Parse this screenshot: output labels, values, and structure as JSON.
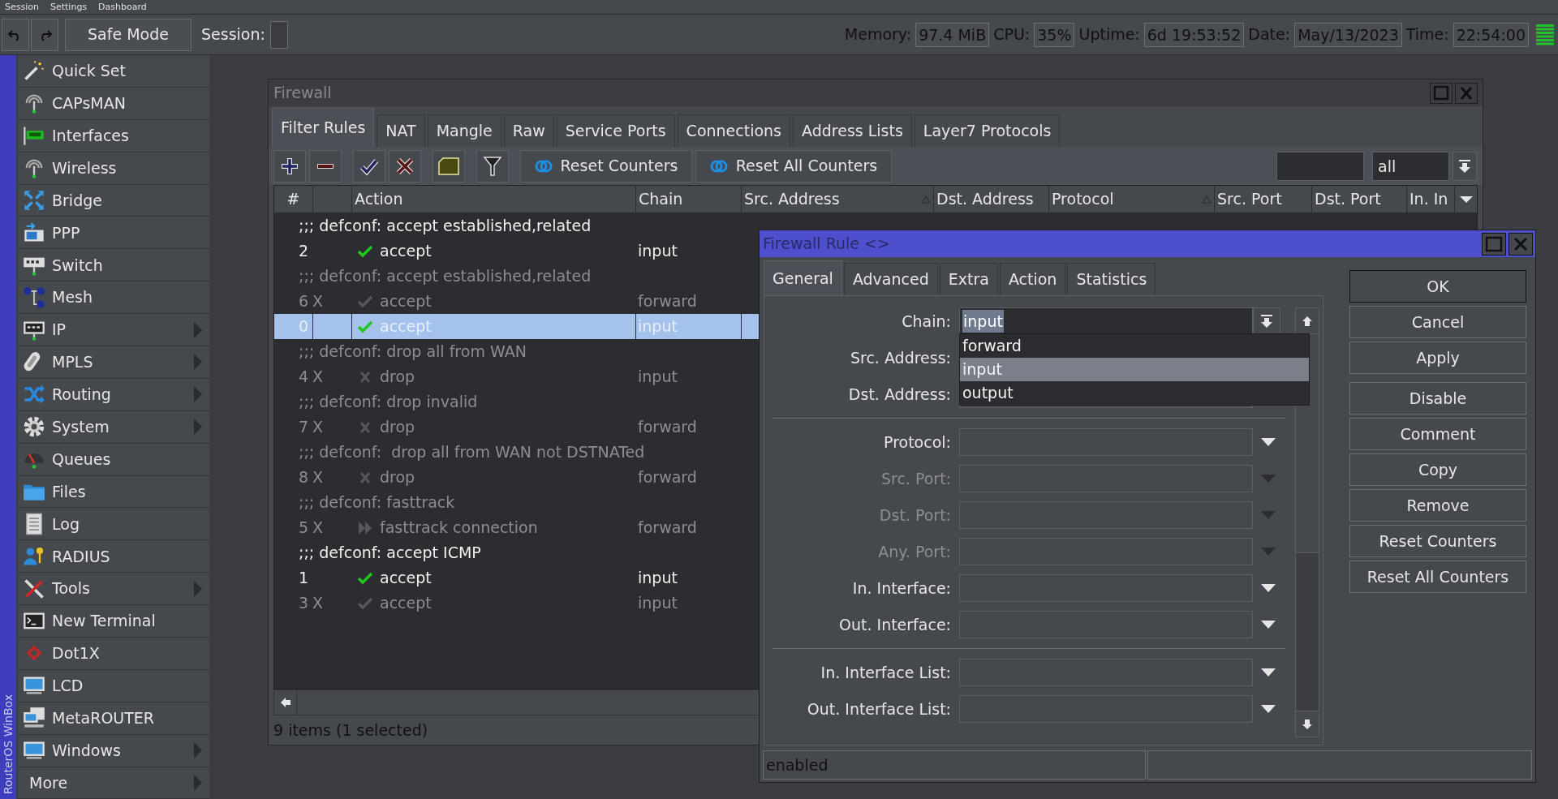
{
  "menu_bar": [
    {
      "label": "Session"
    },
    {
      "label": "Settings"
    },
    {
      "label": "Dashboard"
    }
  ],
  "toolbar": {
    "safe_mode": "Safe Mode",
    "session_label": "Session:",
    "stats": [
      {
        "label": "Memory:",
        "value": "97.4 MiB"
      },
      {
        "label": "CPU:",
        "value": "35%"
      },
      {
        "label": "Uptime:",
        "value": "6d 19:53:52"
      },
      {
        "label": "Date:",
        "value": "May/13/2023"
      },
      {
        "label": "Time:",
        "value": "22:54:00"
      }
    ]
  },
  "sidebar": {
    "brand": "RouterOS WinBox",
    "items": [
      {
        "label": "Quick Set",
        "submenu": false
      },
      {
        "label": "CAPsMAN",
        "submenu": false
      },
      {
        "label": "Interfaces",
        "submenu": false
      },
      {
        "label": "Wireless",
        "submenu": false
      },
      {
        "label": "Bridge",
        "submenu": false
      },
      {
        "label": "PPP",
        "submenu": false
      },
      {
        "label": "Switch",
        "submenu": false
      },
      {
        "label": "Mesh",
        "submenu": false
      },
      {
        "label": "IP",
        "submenu": true
      },
      {
        "label": "MPLS",
        "submenu": true
      },
      {
        "label": "Routing",
        "submenu": true
      },
      {
        "label": "System",
        "submenu": true
      },
      {
        "label": "Queues",
        "submenu": false
      },
      {
        "label": "Files",
        "submenu": false
      },
      {
        "label": "Log",
        "submenu": false
      },
      {
        "label": "RADIUS",
        "submenu": false
      },
      {
        "label": "Tools",
        "submenu": true
      },
      {
        "label": "New Terminal",
        "submenu": false
      },
      {
        "label": "Dot1X",
        "submenu": false
      },
      {
        "label": "LCD",
        "submenu": false
      },
      {
        "label": "MetaROUTER",
        "submenu": false
      },
      {
        "label": "Windows",
        "submenu": true
      },
      {
        "label": "More",
        "submenu": true
      }
    ]
  },
  "firewall": {
    "title": "Firewall",
    "tabs": [
      {
        "label": "Filter Rules",
        "selected": true
      },
      {
        "label": "NAT",
        "selected": false
      },
      {
        "label": "Mangle",
        "selected": false
      },
      {
        "label": "Raw",
        "selected": false
      },
      {
        "label": "Service Ports",
        "selected": false
      },
      {
        "label": "Connections",
        "selected": false
      },
      {
        "label": "Address Lists",
        "selected": false
      },
      {
        "label": "Layer7 Protocols",
        "selected": false
      }
    ],
    "actions": [
      {
        "label": "Reset Counters"
      },
      {
        "label": "Reset All Counters"
      }
    ],
    "filter": {
      "value": "all"
    },
    "columns": [
      {
        "label": "#",
        "sort_indicator": false
      },
      {
        "label": "Action",
        "sort_indicator": false
      },
      {
        "label": "Chain",
        "sort_indicator": false
      },
      {
        "label": "Src. Address",
        "sort_indicator": true
      },
      {
        "label": "Dst. Address",
        "sort_indicator": false
      },
      {
        "label": "Protocol",
        "sort_indicator": true
      },
      {
        "label": "Src. Port",
        "sort_indicator": false
      },
      {
        "label": "Dst. Port",
        "sort_indicator": false
      },
      {
        "label": "In. In",
        "sort_indicator": false
      }
    ],
    "rows": [
      {
        "kind": "comment",
        "text": ";;; defconf: accept established,related",
        "disabled": false
      },
      {
        "kind": "accept_rule",
        "number": "2",
        "action": "accept",
        "chain": "input",
        "disabled": false,
        "selected": false
      },
      {
        "kind": "comment",
        "text": ";;; defconf: accept established,related",
        "disabled": true
      },
      {
        "kind": "accept_rule",
        "number": "6",
        "flag": "X",
        "action": "accept",
        "chain": "forward",
        "disabled": true,
        "selected": false
      },
      {
        "kind": "accept_rule",
        "number": "0",
        "action": "accept",
        "chain": "input",
        "disabled": false,
        "selected": true
      },
      {
        "kind": "comment",
        "text": ";;; defconf: drop all from WAN",
        "disabled": true
      },
      {
        "kind": "drop_rule",
        "number": "4",
        "flag": "X",
        "action": "drop",
        "chain": "input",
        "disabled": true,
        "selected": false
      },
      {
        "kind": "comment",
        "text": ";;; defconf: drop invalid",
        "disabled": true
      },
      {
        "kind": "drop_rule",
        "number": "7",
        "flag": "X",
        "action": "drop",
        "chain": "forward",
        "disabled": true,
        "selected": false
      },
      {
        "kind": "comment",
        "text": ";;; defconf:  drop all from WAN not DSTNATed",
        "disabled": true
      },
      {
        "kind": "drop_rule",
        "number": "8",
        "flag": "X",
        "action": "drop",
        "chain": "forward",
        "disabled": true,
        "selected": false
      },
      {
        "kind": "comment",
        "text": ";;; defconf: fasttrack",
        "disabled": true
      },
      {
        "kind": "fasttrack_rule",
        "number": "5",
        "flag": "X",
        "action": "fasttrack connection",
        "chain": "forward",
        "disabled": true,
        "selected": false
      },
      {
        "kind": "comment",
        "text": ";;; defconf: accept ICMP",
        "disabled": false
      },
      {
        "kind": "accept_rule",
        "number": "1",
        "action": "accept",
        "chain": "input",
        "disabled": false,
        "selected": false
      },
      {
        "kind": "accept_rule",
        "number": "3",
        "flag": "X",
        "action": "accept",
        "chain": "input",
        "disabled": true,
        "selected": false
      }
    ],
    "status": "9 items (1 selected)"
  },
  "rule_dialog": {
    "title": "Firewall Rule <>",
    "tabs": [
      {
        "label": "General",
        "selected": true
      },
      {
        "label": "Advanced",
        "selected": false
      },
      {
        "label": "Extra",
        "selected": false
      },
      {
        "label": "Action",
        "selected": false
      },
      {
        "label": "Statistics",
        "selected": false
      }
    ],
    "field_groups": [
      [
        {
          "label": "Chain:",
          "kind": "combo",
          "value": "input",
          "disabled": false
        },
        {
          "label": "Src. Address:",
          "kind": "covered",
          "disabled": false
        },
        {
          "label": "Dst. Address:",
          "kind": "text",
          "disabled": false
        }
      ],
      [
        {
          "label": "Protocol:",
          "kind": "dropdown",
          "disabled": false
        },
        {
          "label": "Src. Port:",
          "kind": "dropdown",
          "disabled": true
        },
        {
          "label": "Dst. Port:",
          "kind": "dropdown",
          "disabled": true
        },
        {
          "label": "Any. Port:",
          "kind": "dropdown",
          "disabled": true
        },
        {
          "label": "In. Interface:",
          "kind": "dropdown",
          "disabled": false
        },
        {
          "label": "Out. Interface:",
          "kind": "dropdown",
          "disabled": false
        }
      ],
      [
        {
          "label": "In. Interface List:",
          "kind": "dropdown",
          "disabled": false
        },
        {
          "label": "Out. Interface List:",
          "kind": "dropdown",
          "disabled": false
        }
      ]
    ],
    "chain_options": [
      {
        "label": "forward",
        "selected": false
      },
      {
        "label": "input",
        "selected": true
      },
      {
        "label": "output",
        "selected": false
      }
    ],
    "button_groups": [
      [
        {
          "label": "OK",
          "default": true
        },
        {
          "label": "Cancel",
          "default": false
        },
        {
          "label": "Apply",
          "default": false
        }
      ],
      [
        {
          "label": "Disable",
          "default": false
        },
        {
          "label": "Comment",
          "default": false
        },
        {
          "label": "Copy",
          "default": false
        },
        {
          "label": "Remove",
          "default": false
        },
        {
          "label": "Reset Counters",
          "default": false
        },
        {
          "label": "Reset All Counters",
          "default": false
        }
      ]
    ],
    "status": "enabled"
  }
}
